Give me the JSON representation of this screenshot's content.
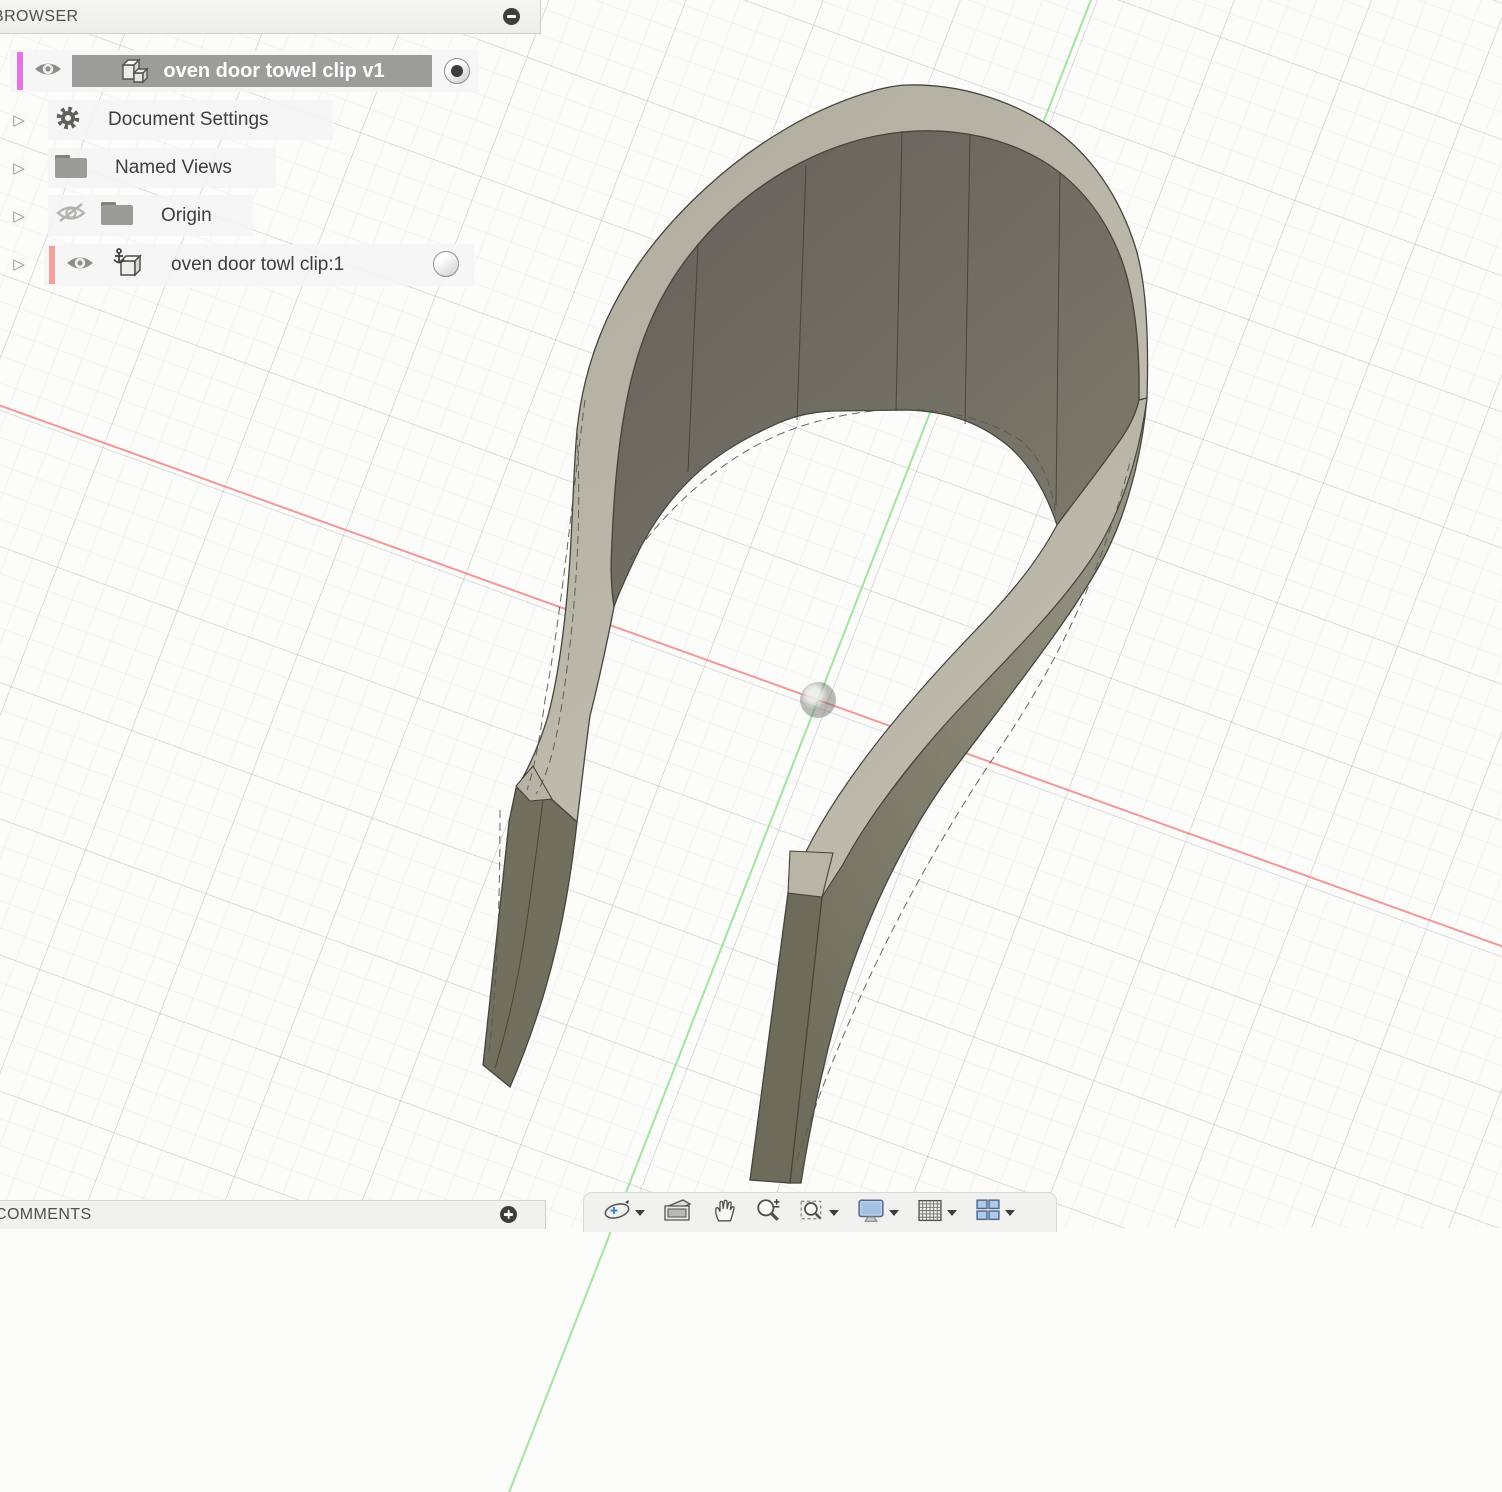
{
  "browser": {
    "title": "BROWSER",
    "rows": [
      {
        "label": "oven door towel clip v1",
        "selected": true,
        "visibility": "shown",
        "activated": true
      },
      {
        "label": "Document Settings",
        "expandable": true
      },
      {
        "label": "Named Views",
        "expandable": true
      },
      {
        "label": "Origin",
        "expandable": true,
        "visibility": "hidden"
      },
      {
        "label": "oven door towl clip:1",
        "expandable": true,
        "visibility": "shown",
        "activated": false
      }
    ]
  },
  "comments": {
    "title": "COMMENTS"
  },
  "toolbar": {
    "items": [
      "orbit",
      "look-at",
      "pan",
      "zoom",
      "window-zoom",
      "display-settings",
      "grid-and-snaps",
      "viewports"
    ]
  },
  "viewport": {
    "model": "oven door towel clip",
    "colors": {
      "axis_x_red": "#f17070",
      "axis_y_green": "#8ade8a",
      "doc_select_pink": "#e473e4",
      "component_select_salmon": "#f2a09c",
      "selected_row_gray": "#9c9c9b",
      "model_light": "#b5b2a4",
      "model_dark": "#6c6a60",
      "model_mid": "#8b897b"
    }
  }
}
